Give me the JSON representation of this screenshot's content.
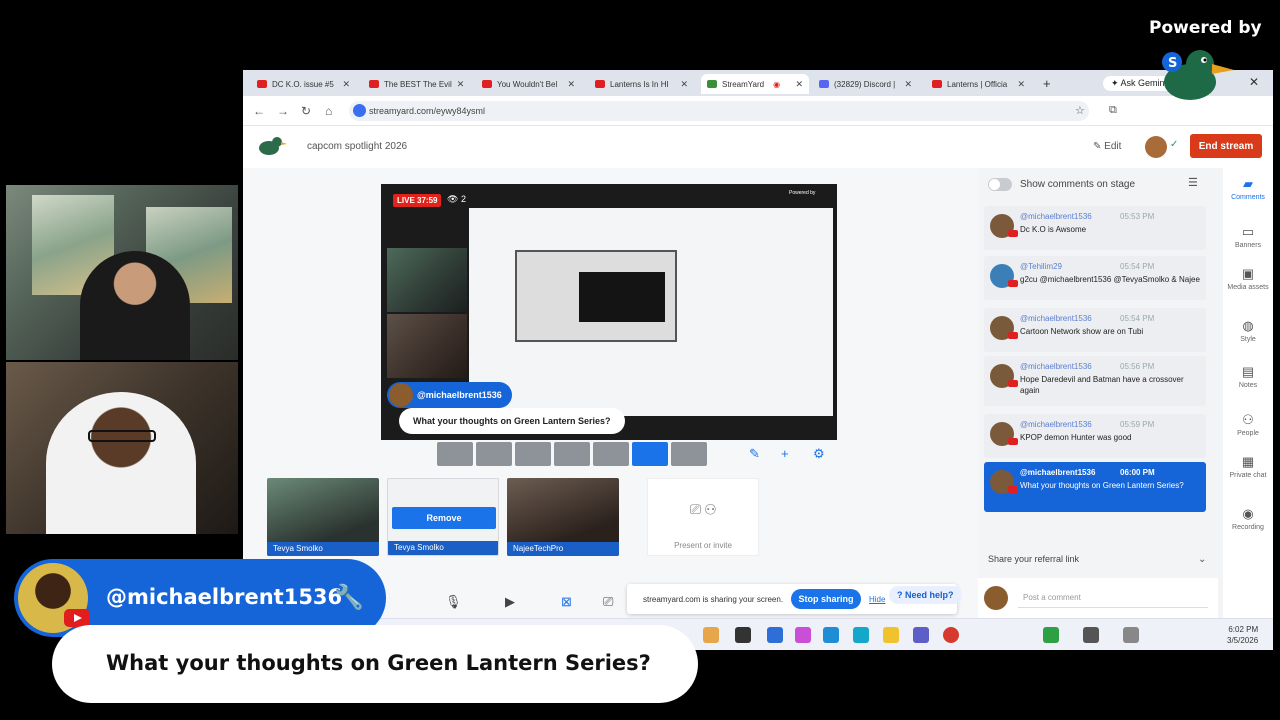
{
  "overlay": {
    "powered_by": "Powered by",
    "streamyard_wordmark": "StreamYard",
    "name_pill": {
      "username": "@michaelbrent1536"
    },
    "question": "What your thoughts on Green Lantern Series?"
  },
  "browser": {
    "tabs": [
      {
        "label": "DC K.O. issue #5"
      },
      {
        "label": "The BEST The Evil"
      },
      {
        "label": "You Wouldn't Bel"
      },
      {
        "label": "Lanterns Is In HI"
      },
      {
        "label": "StreamYard"
      },
      {
        "label": "(32829) Discord |"
      },
      {
        "label": "Lanterns | Officia"
      }
    ],
    "ask_gemini": "Ask Gemini",
    "url": "streamyard.com/eywy84ysml"
  },
  "streamyard": {
    "broadcast_title": "capcom spotlight 2026",
    "edit_label": "Edit",
    "end_stream_label": "End stream",
    "preview": {
      "live_badge": "LIVE 37:59",
      "viewer_count": "2",
      "powered_by": "Powered by",
      "banner_user": "@michaelbrent1536",
      "banner_question": "What your thoughts on Green Lantern Series?"
    },
    "participants": [
      {
        "name": "Tevya Smolko"
      },
      {
        "name": "Tevya Smolko",
        "action": "Remove"
      },
      {
        "name": "NajeeTechPro"
      }
    ],
    "present_label": "Present or invite",
    "share_bar": {
      "message": "streamyard.com is sharing your screen.",
      "stop_label": "Stop sharing",
      "hide_label": "Hide"
    },
    "need_help": "Need help?"
  },
  "comments_panel": {
    "toggle_label": "Show comments on stage",
    "comments": [
      {
        "author": "@michaelbrent1536",
        "time": "05:53 PM",
        "text": "Dc K.O is Awsome"
      },
      {
        "author": "@Tehilim29",
        "time": "05:54 PM",
        "text": "g2cu @michaelbrent1536 @TevyaSmolko & Najee"
      },
      {
        "author": "@michaelbrent1536",
        "time": "05:54 PM",
        "text": "Cartoon Network show are on Tubi"
      },
      {
        "author": "@michaelbrent1536",
        "time": "05:56 PM",
        "text": "Hope Daredevil and Batman have a crossover again"
      },
      {
        "author": "@michaelbrent1536",
        "time": "05:59 PM",
        "text": "KPOP demon Hunter was good"
      },
      {
        "author": "@michaelbrent1536",
        "time": "06:00 PM",
        "text": "What your thoughts on Green Lantern Series?"
      }
    ],
    "referral_label": "Share your referral link",
    "post_placeholder": "Post a comment"
  },
  "tools": [
    {
      "label": "Comments"
    },
    {
      "label": "Banners"
    },
    {
      "label": "Media assets"
    },
    {
      "label": "Style"
    },
    {
      "label": "Notes"
    },
    {
      "label": "People"
    },
    {
      "label": "Private chat"
    },
    {
      "label": "Recording"
    }
  ],
  "taskbar": {
    "time": "6:02 PM",
    "date": "3/5/2026"
  },
  "colors": {
    "accent_blue": "#1565d8",
    "end_stream_red": "#d83a1a",
    "live_red": "#e0241c"
  }
}
